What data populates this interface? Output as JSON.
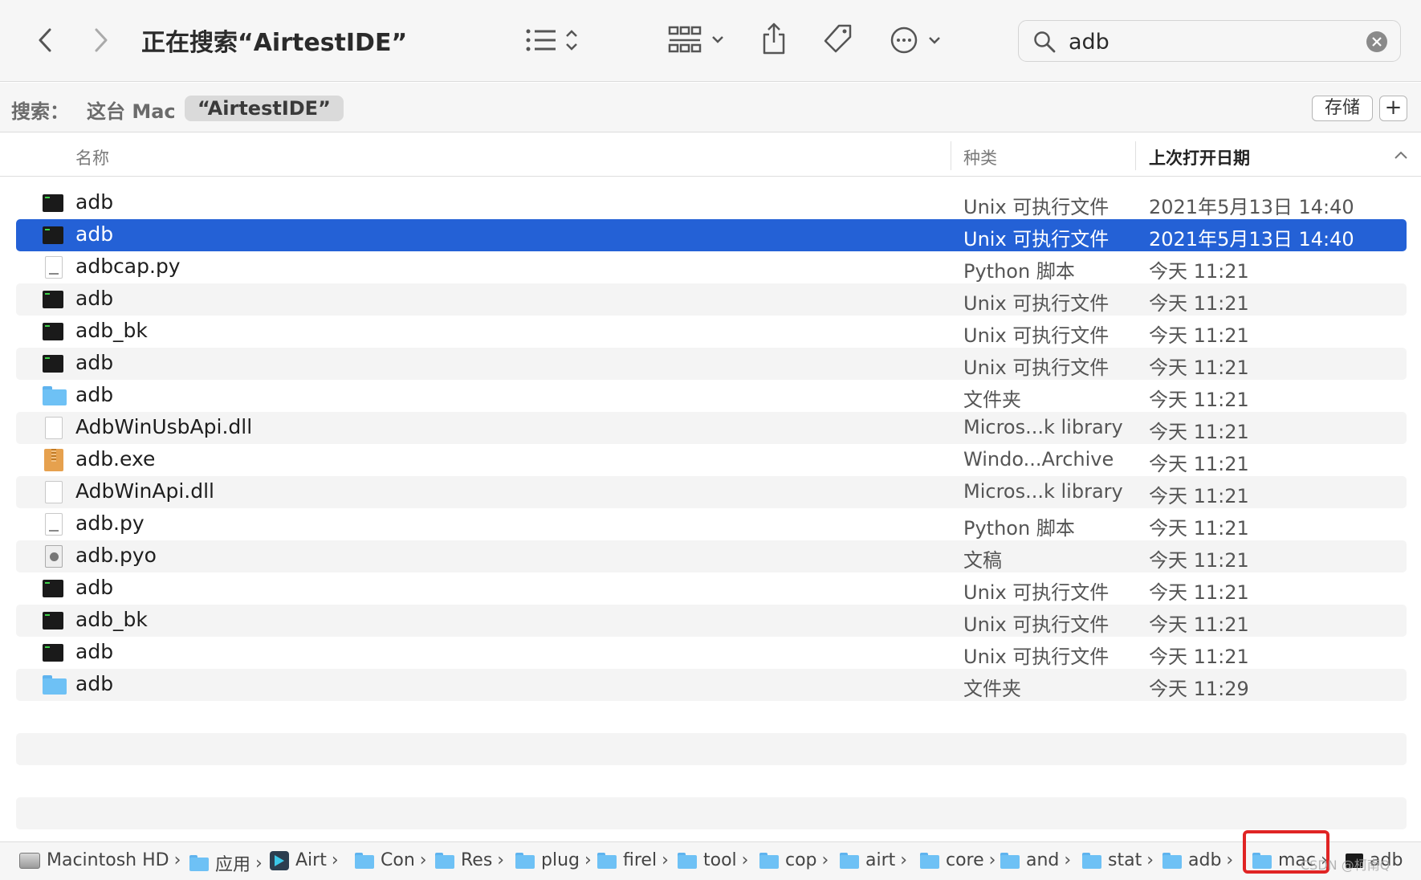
{
  "toolbar": {
    "title": "正在搜索“AirtestIDE”",
    "search_value": "adb"
  },
  "scope": {
    "label": "搜索：",
    "this_mac": "这台 Mac",
    "folder": "“AirtestIDE”",
    "save_label": "存储",
    "add_label": "+"
  },
  "columns": {
    "name": "名称",
    "kind": "种类",
    "date": "上次打开日期"
  },
  "rows": [
    {
      "icon": "terminal-icon",
      "name": "adb",
      "kind": "Unix 可执行文件",
      "date": "2021年5月13日 14:40"
    },
    {
      "icon": "terminal-icon",
      "name": "adb",
      "kind": "Unix 可执行文件",
      "date": "2021年5月13日 14:40",
      "selected": true
    },
    {
      "icon": "python-script-icon",
      "name": "adbcap.py",
      "kind": "Python 脚本",
      "date": "今天 11:21"
    },
    {
      "icon": "terminal-icon",
      "name": "adb",
      "kind": "Unix 可执行文件",
      "date": "今天 11:21"
    },
    {
      "icon": "terminal-icon",
      "name": "adb_bk",
      "kind": "Unix 可执行文件",
      "date": "今天 11:21"
    },
    {
      "icon": "terminal-icon",
      "name": "adb",
      "kind": "Unix 可执行文件",
      "date": "今天 11:21"
    },
    {
      "icon": "folder-icon",
      "name": "adb",
      "kind": "文件夹",
      "date": "今天 11:21"
    },
    {
      "icon": "document-icon",
      "name": "AdbWinUsbApi.dll",
      "kind": "Micros...k library",
      "date": "今天 11:21"
    },
    {
      "icon": "archive-icon",
      "name": "adb.exe",
      "kind": "Windo...Archive",
      "date": "今天 11:21"
    },
    {
      "icon": "document-icon",
      "name": "AdbWinApi.dll",
      "kind": "Micros...k library",
      "date": "今天 11:21"
    },
    {
      "icon": "python-script-icon",
      "name": "adb.py",
      "kind": "Python 脚本",
      "date": "今天 11:21"
    },
    {
      "icon": "compiled-file-icon",
      "name": "adb.pyo",
      "kind": "文稿",
      "date": "今天 11:21"
    },
    {
      "icon": "terminal-icon",
      "name": "adb",
      "kind": "Unix 可执行文件",
      "date": "今天 11:21"
    },
    {
      "icon": "terminal-icon",
      "name": "adb_bk",
      "kind": "Unix 可执行文件",
      "date": "今天 11:21"
    },
    {
      "icon": "terminal-icon",
      "name": "adb",
      "kind": "Unix 可执行文件",
      "date": "今天 11:21"
    },
    {
      "icon": "folder-icon",
      "name": "adb",
      "kind": "文件夹",
      "date": "今天 11:29"
    }
  ],
  "pathbar": [
    {
      "icon": "hard-drive-icon",
      "label": "Macintosh HD"
    },
    {
      "icon": "folder-icon",
      "label": "应用"
    },
    {
      "icon": "app-icon",
      "label": "Airt"
    },
    {
      "icon": "folder-icon",
      "label": "Con"
    },
    {
      "icon": "folder-icon",
      "label": "Res"
    },
    {
      "icon": "folder-icon",
      "label": "plug"
    },
    {
      "icon": "folder-icon",
      "label": "firel"
    },
    {
      "icon": "folder-icon",
      "label": "tool"
    },
    {
      "icon": "folder-icon",
      "label": "cop"
    },
    {
      "icon": "folder-icon",
      "label": "airt"
    },
    {
      "icon": "folder-icon",
      "label": "core"
    },
    {
      "icon": "folder-icon",
      "label": "and"
    },
    {
      "icon": "folder-icon",
      "label": "stat"
    },
    {
      "icon": "folder-icon",
      "label": "adb"
    },
    {
      "icon": "folder-icon",
      "label": "mac"
    },
    {
      "icon": "terminal-icon",
      "label": "adb"
    }
  ],
  "watermark": "CSDN @柯南Q",
  "colors": {
    "selection": "#2461d6",
    "highlight_box": "#e02424"
  }
}
